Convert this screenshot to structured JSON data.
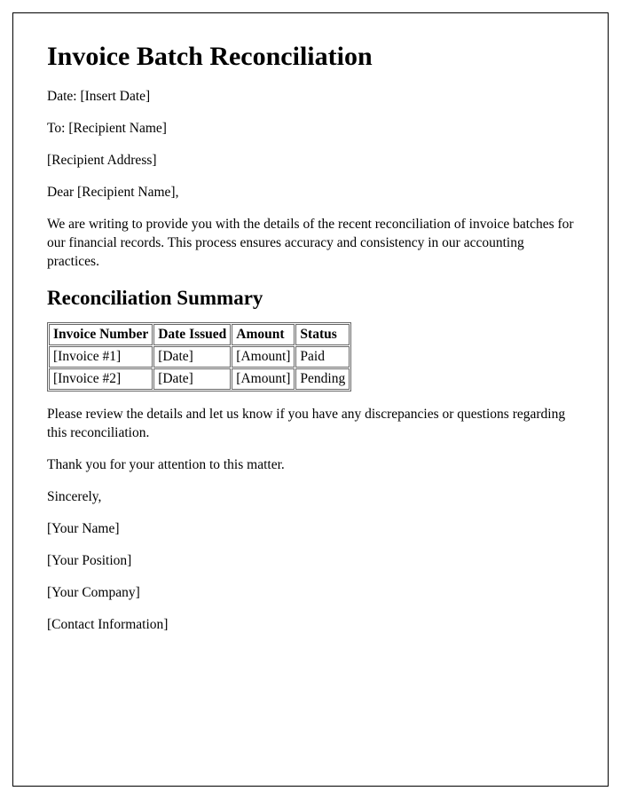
{
  "title": "Invoice Batch Reconciliation",
  "date_line": "Date: [Insert Date]",
  "to_line": "To: [Recipient Name]",
  "address_line": "[Recipient Address]",
  "salutation": "Dear [Recipient Name],",
  "intro_para": "We are writing to provide you with the details of the recent reconciliation of invoice batches for our financial records. This process ensures accuracy and consistency in our accounting practices.",
  "summary_heading": "Reconciliation Summary",
  "table": {
    "headers": {
      "c0": "Invoice Number",
      "c1": "Date Issued",
      "c2": "Amount",
      "c3": "Status"
    },
    "rows": [
      {
        "c0": "[Invoice #1]",
        "c1": "[Date]",
        "c2": "[Amount]",
        "c3": "Paid"
      },
      {
        "c0": "[Invoice #2]",
        "c1": "[Date]",
        "c2": "[Amount]",
        "c3": "Pending"
      }
    ]
  },
  "review_para": "Please review the details and let us know if you have any discrepancies or questions regarding this reconciliation.",
  "thanks_line": "Thank you for your attention to this matter.",
  "closing": "Sincerely,",
  "signer_name": "[Your Name]",
  "signer_position": "[Your Position]",
  "signer_company": "[Your Company]",
  "signer_contact": "[Contact Information]"
}
